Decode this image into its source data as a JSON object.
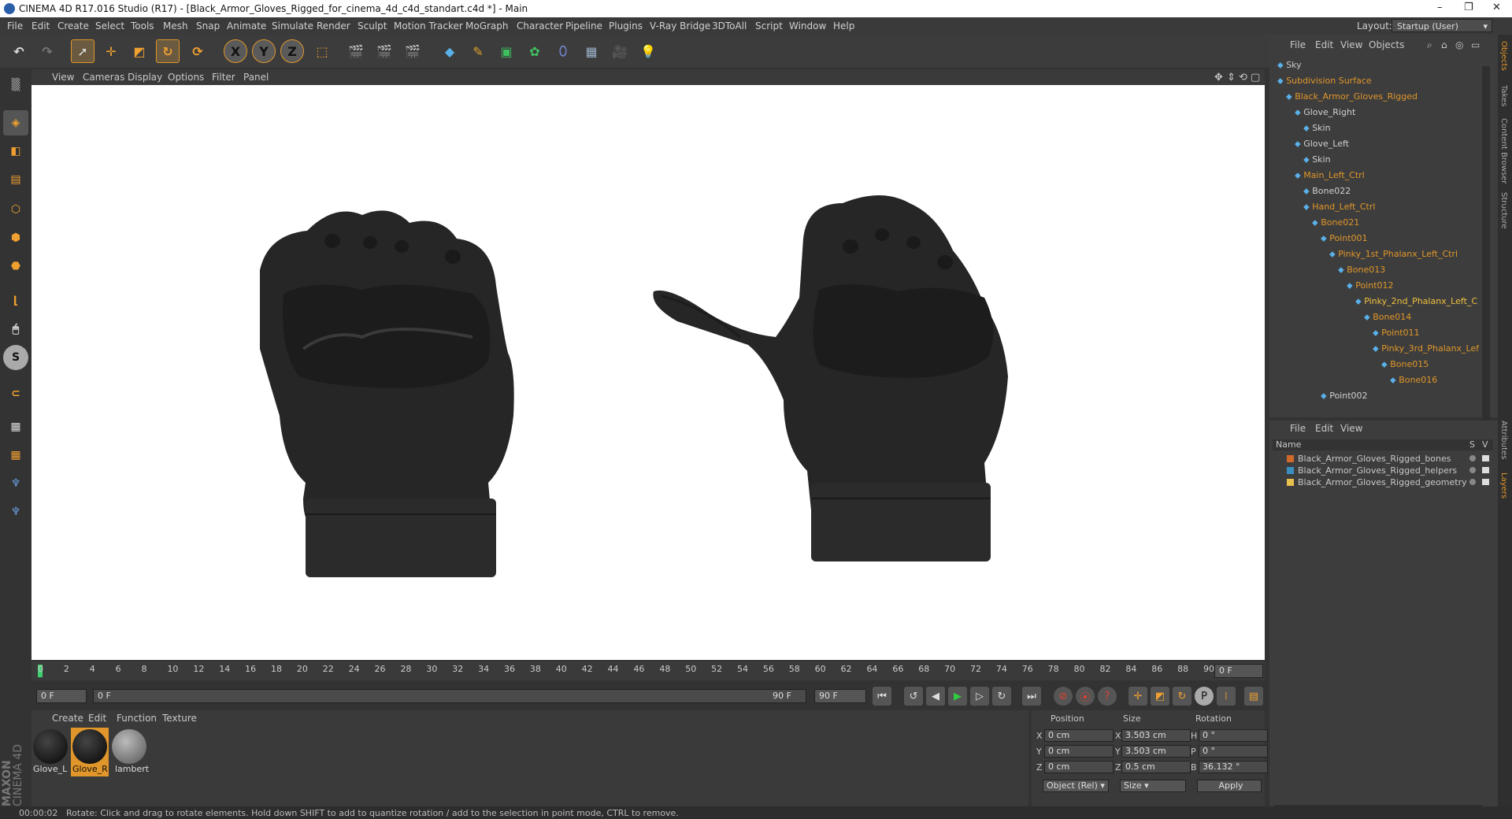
{
  "window": {
    "title": "CINEMA 4D R17.016 Studio (R17) - [Black_Armor_Gloves_Rigged_for_cinema_4d_c4d_standart.c4d *] - Main",
    "controls": [
      "–",
      "❐",
      "✕"
    ]
  },
  "menubar": {
    "items": [
      "File",
      "Edit",
      "Create",
      "Select",
      "Tools",
      "Mesh",
      "Snap",
      "Animate",
      "Simulate",
      "Render",
      "Sculpt",
      "Motion Tracker",
      "MoGraph",
      "Character",
      "Pipeline",
      "Plugins",
      "V-Ray Bridge",
      "3DToAll",
      "Script",
      "Window",
      "Help"
    ],
    "layout_label": "Layout:",
    "layout_value": "Startup (User)"
  },
  "toolbar": {
    "axis_labels": [
      "X",
      "Y",
      "Z"
    ]
  },
  "viewport": {
    "menu": [
      "View",
      "Cameras",
      "Display",
      "Options",
      "Filter",
      "Panel"
    ]
  },
  "timeline": {
    "ticks": [
      "0",
      "2",
      "4",
      "6",
      "8",
      "10",
      "12",
      "14",
      "16",
      "18",
      "20",
      "22",
      "24",
      "26",
      "28",
      "30",
      "32",
      "34",
      "36",
      "38",
      "40",
      "42",
      "44",
      "46",
      "48",
      "50",
      "52",
      "54",
      "56",
      "58",
      "60",
      "62",
      "64",
      "66",
      "68",
      "70",
      "72",
      "74",
      "76",
      "78",
      "80",
      "82",
      "84",
      "86",
      "88",
      "90"
    ],
    "current_frame": "0 F"
  },
  "transport": {
    "start": "0 F",
    "range_left": "0 F",
    "range_right": "90 F",
    "end": "90 F"
  },
  "materials": {
    "menu": [
      "Create",
      "Edit",
      "Function",
      "Texture"
    ],
    "items": [
      {
        "label": "Glove_L",
        "selected": false
      },
      {
        "label": "Glove_R",
        "selected": true
      },
      {
        "label": "lambert",
        "selected": false
      }
    ]
  },
  "coordinates": {
    "headers": [
      "Position",
      "Size",
      "Rotation"
    ],
    "rows": [
      {
        "axis": "X",
        "pos": "0 cm",
        "saxis": "X",
        "size": "3.503 cm",
        "raxis": "H",
        "rot": "0 °"
      },
      {
        "axis": "Y",
        "pos": "0 cm",
        "saxis": "Y",
        "size": "3.503 cm",
        "raxis": "P",
        "rot": "0 °"
      },
      {
        "axis": "Z",
        "pos": "0 cm",
        "saxis": "Z",
        "size": "0.5 cm",
        "raxis": "B",
        "rot": "36.132 °"
      }
    ],
    "mode": "Object (Rel)",
    "size_mode": "Size",
    "apply": "Apply"
  },
  "object_manager": {
    "menu": [
      "File",
      "Edit",
      "View",
      "Objects"
    ],
    "rows": [
      {
        "label": "Sky",
        "indent": 0,
        "color": "#c8c8c8"
      },
      {
        "label": "Subdivision Surface",
        "indent": 0,
        "color": "#e0962a"
      },
      {
        "label": "Black_Armor_Gloves_Rigged",
        "indent": 1,
        "color": "#e0962a"
      },
      {
        "label": "Glove_Right",
        "indent": 2,
        "color": "#d0d0d0"
      },
      {
        "label": "Skin",
        "indent": 3,
        "color": "#d0d0d0"
      },
      {
        "label": "Glove_Left",
        "indent": 2,
        "color": "#d0d0d0"
      },
      {
        "label": "Skin",
        "indent": 3,
        "color": "#d0d0d0"
      },
      {
        "label": "Main_Left_Ctrl",
        "indent": 2,
        "color": "#e0962a"
      },
      {
        "label": "Bone022",
        "indent": 3,
        "color": "#d0d0d0"
      },
      {
        "label": "Hand_Left_Ctrl",
        "indent": 3,
        "color": "#e0962a"
      },
      {
        "label": "Bone021",
        "indent": 4,
        "color": "#e0962a"
      },
      {
        "label": "Point001",
        "indent": 5,
        "color": "#e0962a"
      },
      {
        "label": "Pinky_1st_Phalanx_Left_Ctrl",
        "indent": 6,
        "color": "#e0962a"
      },
      {
        "label": "Bone013",
        "indent": 7,
        "color": "#e0962a"
      },
      {
        "label": "Point012",
        "indent": 8,
        "color": "#e0962a"
      },
      {
        "label": "Pinky_2nd_Phalanx_Left_C",
        "indent": 9,
        "color": "#f0c040"
      },
      {
        "label": "Bone014",
        "indent": 10,
        "color": "#e0962a"
      },
      {
        "label": "Point011",
        "indent": 11,
        "color": "#e0962a"
      },
      {
        "label": "Pinky_3rd_Phalanx_Lef",
        "indent": 11,
        "color": "#e0962a"
      },
      {
        "label": "Bone015",
        "indent": 12,
        "color": "#e0962a"
      },
      {
        "label": "Bone016",
        "indent": 13,
        "color": "#e0962a"
      },
      {
        "label": "Point002",
        "indent": 5,
        "color": "#d0d0d0"
      }
    ]
  },
  "layer_manager": {
    "menu": [
      "File",
      "Edit",
      "View"
    ],
    "col_name": "Name",
    "col_s": "S",
    "col_v": "V",
    "layers": [
      {
        "name": "Black_Armor_Gloves_Rigged_bones",
        "color": "#d06a2a"
      },
      {
        "name": "Black_Armor_Gloves_Rigged_helpers",
        "color": "#3a8ec0"
      },
      {
        "name": "Black_Armor_Gloves_Rigged_geometry",
        "color": "#e8c050"
      }
    ]
  },
  "side_tabs": [
    "Objects",
    "Takes",
    "Content Browser",
    "Structure",
    "Attributes",
    "Layers"
  ],
  "status": {
    "time": "00:00:02",
    "message": "Rotate: Click and drag to rotate elements. Hold down SHIFT to add to quantize rotation / add to the selection in point mode, CTRL to remove."
  },
  "logo": {
    "brand": "MAXON",
    "product": "CINEMA 4D"
  },
  "colors": {
    "accent": "#e0962a",
    "selected": "#f0c040",
    "play": "#2ecc40"
  }
}
